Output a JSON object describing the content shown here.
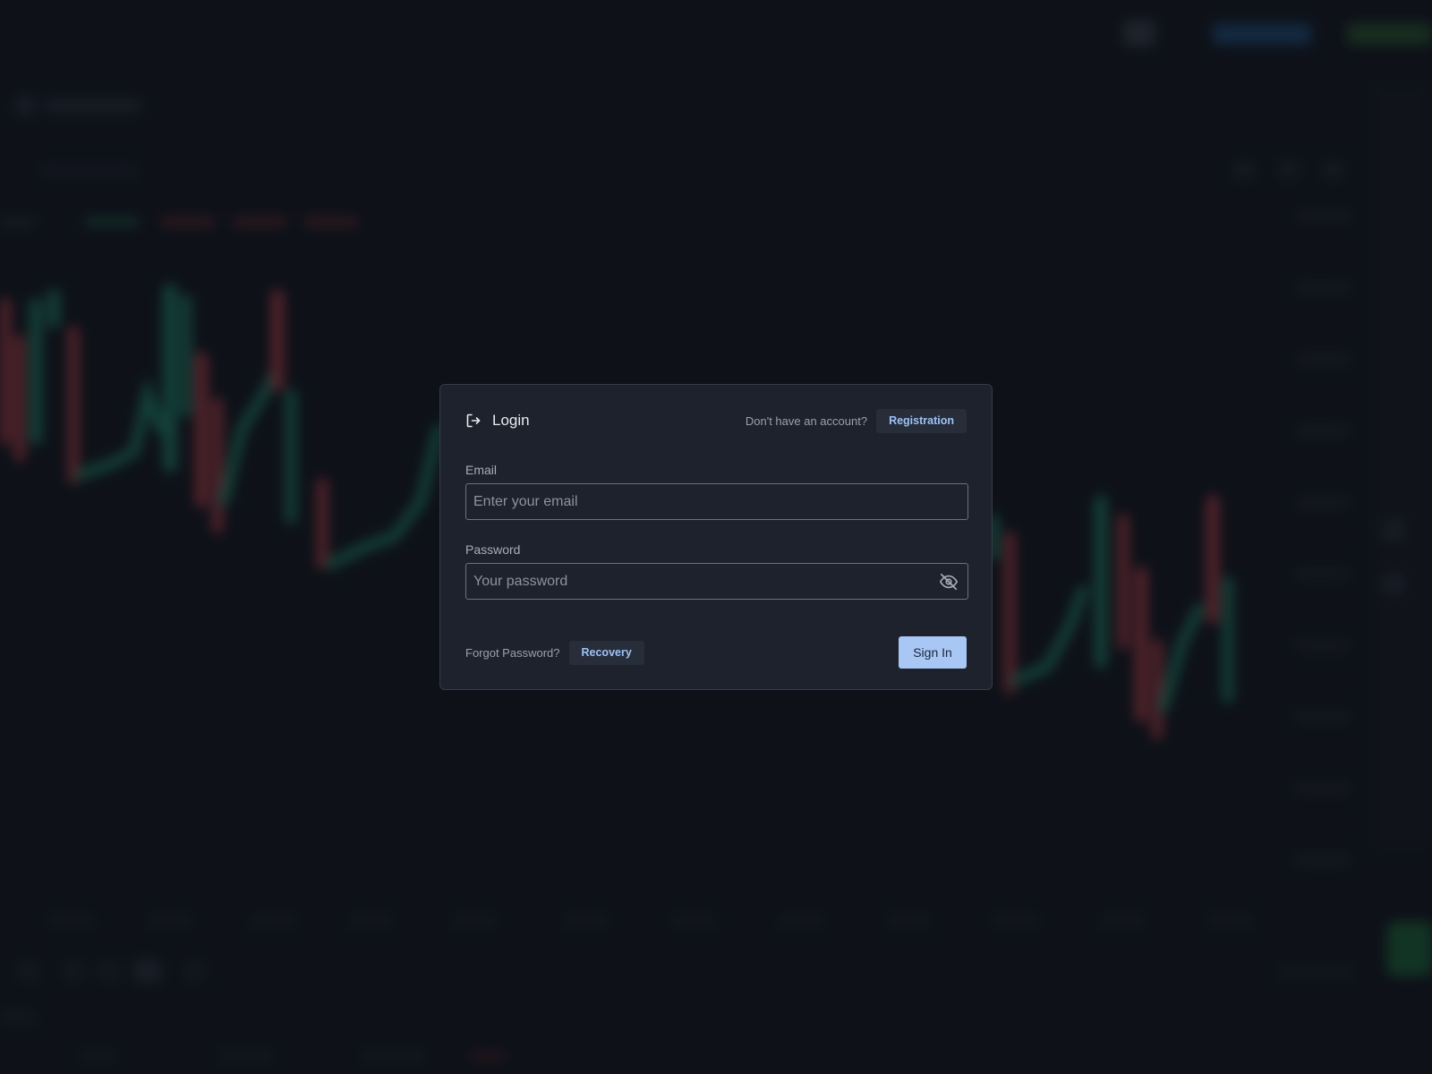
{
  "modal": {
    "title": "Login",
    "registration_prompt": "Don't have an account?",
    "registration_button": "Registration",
    "email": {
      "label": "Email",
      "value": "",
      "placeholder": "Enter your email"
    },
    "password": {
      "label": "Password",
      "value": "",
      "placeholder": "Your password",
      "toggle_icon": "eye-off-icon"
    },
    "forgot_prompt": "Forgot Password?",
    "recovery_button": "Recovery",
    "signin_button": "Sign In",
    "title_icon": "login-arrow-icon"
  },
  "colors": {
    "background": "#11151d",
    "modal_bg": "#1d222c",
    "accent": "#a9c7f5",
    "link_text": "#9ec2f7",
    "candle_up": "#1f8a6a",
    "candle_down": "#c0424b"
  }
}
